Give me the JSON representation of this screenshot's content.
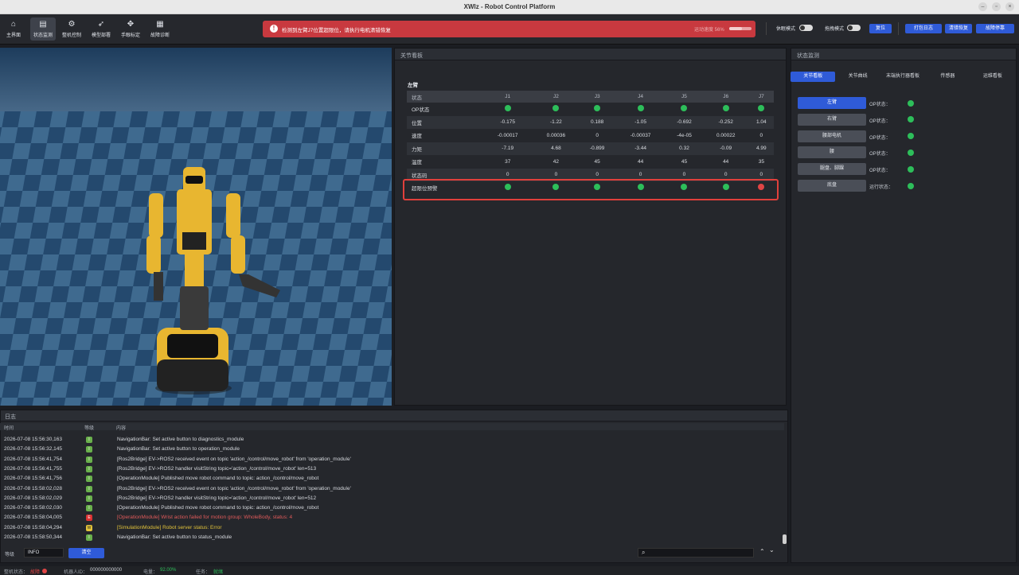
{
  "window": {
    "title": "XWlz - Robot Control Platform"
  },
  "nav": [
    {
      "label": "主界面",
      "icon": "home-icon",
      "glyph": "⌂"
    },
    {
      "label": "状态监测",
      "icon": "monitor-icon",
      "glyph": "▤"
    },
    {
      "label": "整机控制",
      "icon": "robot-control-icon",
      "glyph": "⚙"
    },
    {
      "label": "模型部署",
      "icon": "rocket-icon",
      "glyph": "➶"
    },
    {
      "label": "手眼标定",
      "icon": "calibration-icon",
      "glyph": "✥"
    },
    {
      "label": "故障诊断",
      "icon": "diagnosis-icon",
      "glyph": "▦"
    }
  ],
  "alert": {
    "text": "检测到左臂J7位置超限位，请执行电机清错恢复",
    "progress_label": "运动速度 56%",
    "progress": 0.56
  },
  "toolbar": {
    "sleep_mode": "休眠模式",
    "drag_mode": "拖拽模式",
    "reset": "复位",
    "pack_log": "打包日志",
    "clear_error": "清错恢复",
    "fault_stop": "故障停靠"
  },
  "joint_panel": {
    "title": "关节看板",
    "section": "左臂",
    "columns": [
      "状态",
      "J1",
      "J2",
      "J3",
      "J4",
      "J5",
      "J6",
      "J7"
    ],
    "rows": [
      {
        "label": "OP状态",
        "dots": [
          "green",
          "green",
          "green",
          "green",
          "green",
          "green",
          "green"
        ]
      },
      {
        "label": "位置",
        "values": [
          "-0.175",
          "-1.22",
          "0.188",
          "-1.05",
          "-0.692",
          "-0.252",
          "1.04"
        ]
      },
      {
        "label": "速度",
        "values": [
          "-0.00017",
          "0.00036",
          "0",
          "-0.00037",
          "-4e-05",
          "0.00022",
          "0"
        ]
      },
      {
        "label": "力矩",
        "values": [
          "-7.19",
          "4.68",
          "-0.899",
          "-3.44",
          "0.32",
          "-0.09",
          "4.99"
        ]
      },
      {
        "label": "温度",
        "values": [
          "37",
          "42",
          "45",
          "44",
          "45",
          "44",
          "35"
        ]
      },
      {
        "label": "状态码",
        "values": [
          "0",
          "0",
          "0",
          "0",
          "0",
          "0",
          "0"
        ]
      },
      {
        "label": "超限位预警",
        "dots": [
          "green",
          "green",
          "green",
          "green",
          "green",
          "green",
          "red"
        ]
      }
    ]
  },
  "status_panel": {
    "title": "状态监测",
    "tabs": [
      "关节看板",
      "关节曲线",
      "末端执行器看板",
      "传感器",
      "运维看板"
    ],
    "items": [
      {
        "label": "左臂",
        "status_label": "OP状态："
      },
      {
        "label": "右臂",
        "status_label": "OP状态："
      },
      {
        "label": "腰部电机",
        "status_label": "OP状态："
      },
      {
        "label": "腰",
        "status_label": "OP状态："
      },
      {
        "label": "腿盘、脚踝",
        "status_label": "OP状态："
      },
      {
        "label": "底盘",
        "status_label": "运行状态："
      }
    ]
  },
  "log": {
    "title": "日志",
    "columns": [
      "时间",
      "等级",
      "内容"
    ],
    "rows": [
      {
        "time": "2026-07-08 15:56:30,163",
        "level": "I",
        "msg": "NavigationBar: Set active button to diagnostics_module"
      },
      {
        "time": "2026-07-08 15:56:32,145",
        "level": "I",
        "msg": "NavigationBar: Set active button to operation_module"
      },
      {
        "time": "2026-07-08 15:56:41,754",
        "level": "I",
        "msg": "[Ros2Bridge] EV->ROS2 received event on topic 'action_/control/move_robot' from 'operation_module'"
      },
      {
        "time": "2026-07-08 15:56:41,755",
        "level": "I",
        "msg": "[Ros2Bridge] EV->ROS2 handler visitString topic='action_/control/move_robot' len=513"
      },
      {
        "time": "2026-07-08 15:56:41,756",
        "level": "I",
        "msg": "[OperationModule] Published move robot command to topic: action_/control/move_robot"
      },
      {
        "time": "2026-07-08 15:58:02,028",
        "level": "I",
        "msg": "[Ros2Bridge] EV->ROS2 received event on topic 'action_/control/move_robot' from 'operation_module'"
      },
      {
        "time": "2026-07-08 15:58:02,029",
        "level": "I",
        "msg": "[Ros2Bridge] EV->ROS2 handler visitString topic='action_/control/move_robot' len=512"
      },
      {
        "time": "2026-07-08 15:58:02,030",
        "level": "I",
        "msg": "[OperationModule] Published move robot command to topic: action_/control/move_robot"
      },
      {
        "time": "2026-07-08 15:58:04,005",
        "level": "E",
        "msg": "[OperationModule] Wrist action failed for motion group: WholeBody, status: 4"
      },
      {
        "time": "2026-07-08 15:58:04,294",
        "level": "W",
        "msg": "[SimulationModule] Robot server status: Error"
      },
      {
        "time": "2026-07-08 15:58:50,344",
        "level": "I",
        "msg": "NavigationBar: Set active button to status_module"
      }
    ],
    "level_label": "等级",
    "level_value": "INFO",
    "clear": "清空"
  },
  "statusbar": {
    "machine_label": "整机状态：",
    "machine_value": "故障",
    "robot_id_label": "机器人ID：",
    "robot_id": "000000000000",
    "battery_label": "电量：",
    "battery": "92.00%",
    "task_label": "任务：",
    "task_value": "就绪"
  },
  "colors": {
    "accent": "#2f5bd8",
    "alert": "#c8393f",
    "ok": "#2dbe5a",
    "error": "#e04545",
    "ready": "#2dbe5a"
  }
}
